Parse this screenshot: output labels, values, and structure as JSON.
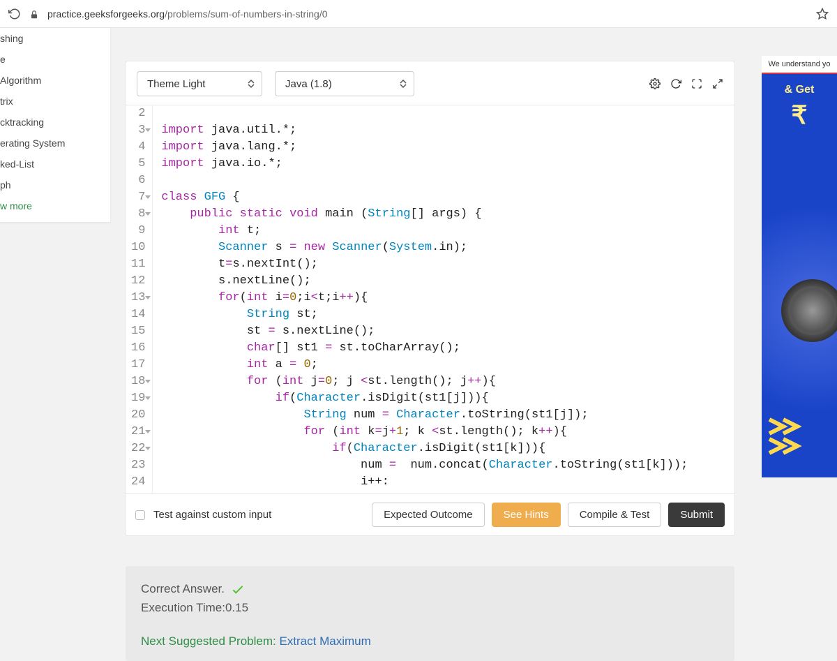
{
  "url": {
    "host": "practice.geeksforgeeks.org",
    "path": "/problems/sum-of-numbers-in-string/0"
  },
  "sidebar": {
    "items": [
      "shing",
      "e",
      "Algorithm",
      "trix",
      "cktracking",
      "erating System",
      "ked-List",
      "ph"
    ],
    "more": "w more"
  },
  "toolbar": {
    "theme": "Theme Light",
    "lang": "Java (1.8)"
  },
  "code": {
    "lines": [
      2,
      3,
      4,
      5,
      6,
      7,
      8,
      9,
      10,
      11,
      12,
      13,
      14,
      15,
      16,
      17,
      18,
      19,
      20,
      21,
      22,
      23,
      24
    ],
    "fold_lines": [
      3,
      7,
      8,
      13,
      18,
      19,
      21,
      22
    ]
  },
  "footer": {
    "custom_input": "Test against custom input",
    "expected": "Expected Outcome",
    "hints": "See Hints",
    "compile": "Compile & Test",
    "submit": "Submit"
  },
  "result": {
    "correct": "Correct Answer.",
    "exec": "Execution Time:0.15",
    "suggest_lead": "Next Suggested Problem: ",
    "suggest_link": "Extract Maximum"
  },
  "ad": {
    "top": "We understand yo",
    "text": "& Get",
    "rupee": "₹"
  }
}
